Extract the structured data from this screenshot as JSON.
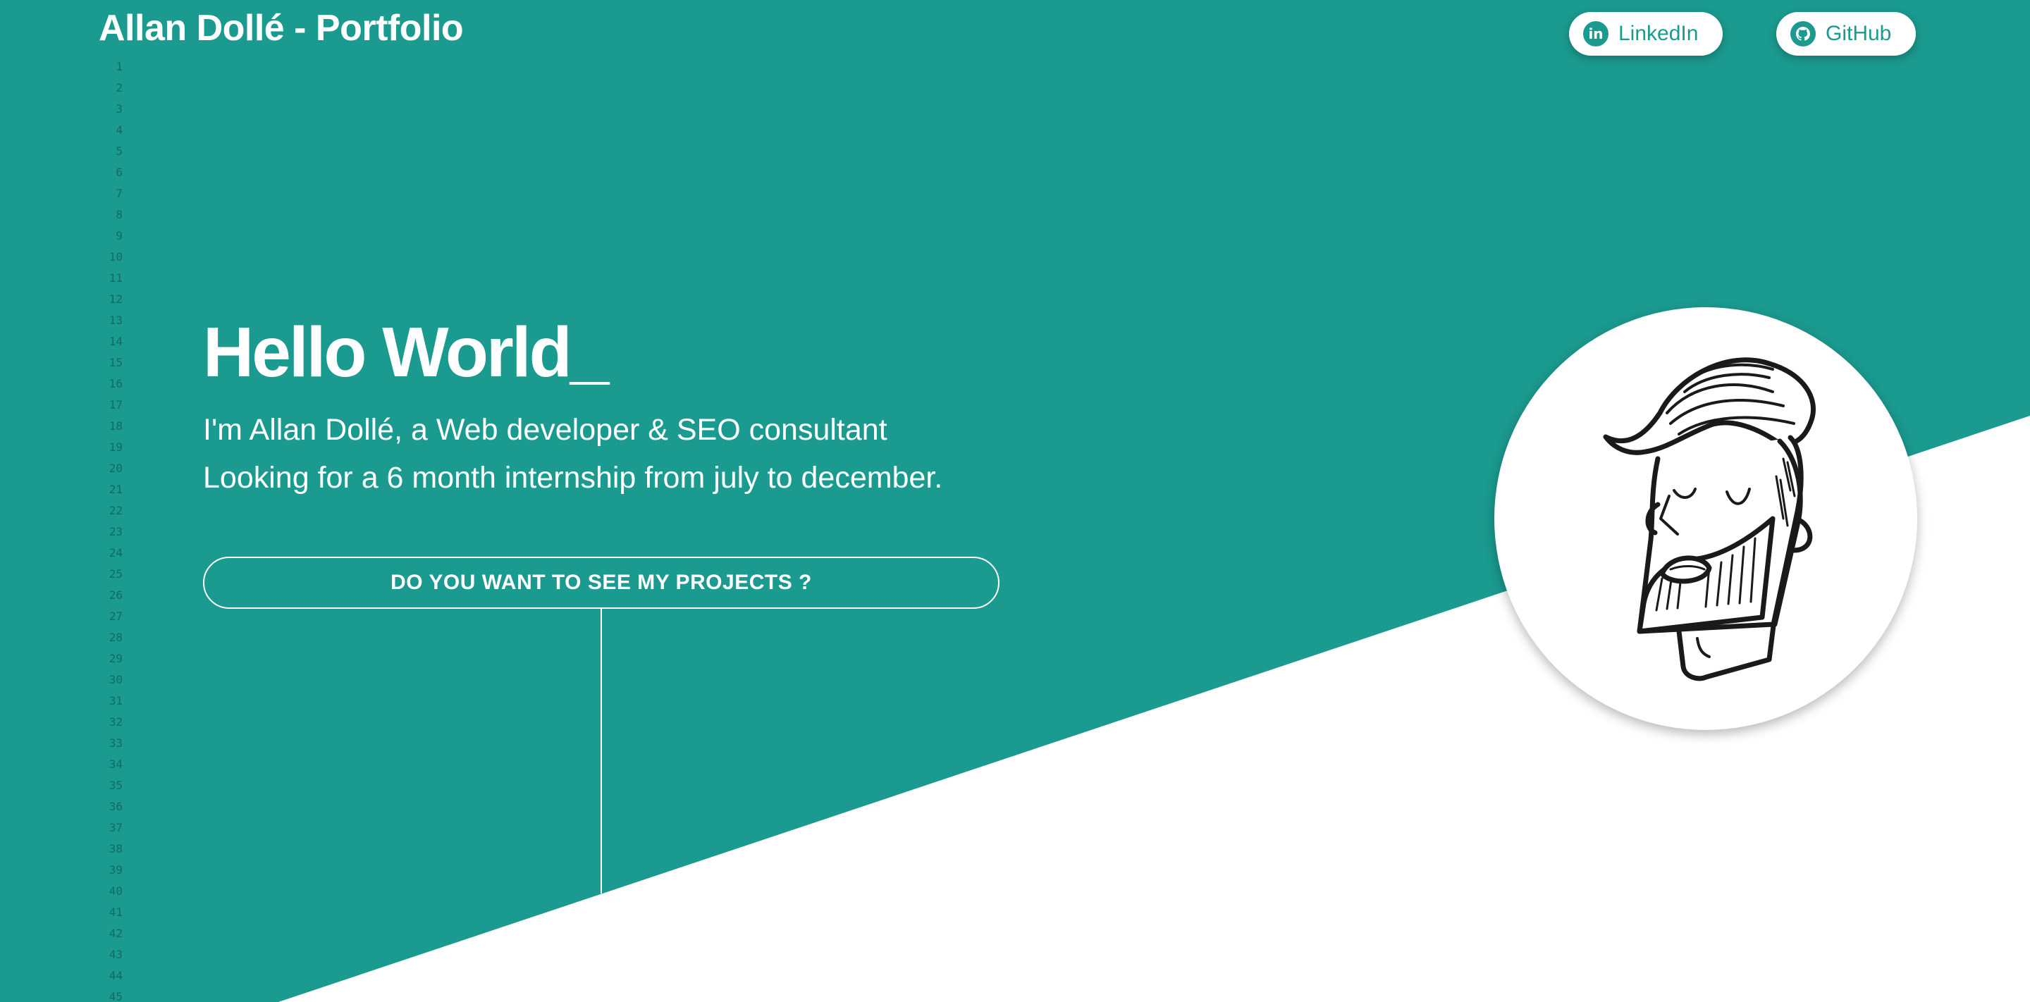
{
  "header": {
    "title": "Allan Dollé - Portfolio",
    "linkedin_label": "LinkedIn",
    "linkedin_icon": "linkedin-icon",
    "github_label": "GitHub",
    "github_icon": "github-icon"
  },
  "line_numbers": [
    "1",
    "2",
    "3",
    "4",
    "5",
    "6",
    "7",
    "8",
    "9",
    "10",
    "11",
    "12",
    "13",
    "14",
    "15",
    "16",
    "17",
    "18",
    "19",
    "20",
    "21",
    "22",
    "23",
    "24",
    "25",
    "26",
    "27",
    "28",
    "29",
    "30",
    "31",
    "32",
    "33",
    "34",
    "35",
    "36",
    "37",
    "38",
    "39",
    "40",
    "41",
    "42",
    "43",
    "44",
    "45"
  ],
  "hero": {
    "heading": "Hello World_",
    "intro_line1": "I'm Allan Dollé, a Web developer & SEO consultant",
    "intro_line2": "Looking for a 6 month internship from july to december.",
    "cta_label": "DO YOU WANT TO SEE MY PROJECTS ?"
  },
  "avatar": {
    "icon": "bearded-man-illustration"
  },
  "colors": {
    "background": "#1b9a8f",
    "wedge": "#ffffff",
    "text": "#ffffff"
  }
}
